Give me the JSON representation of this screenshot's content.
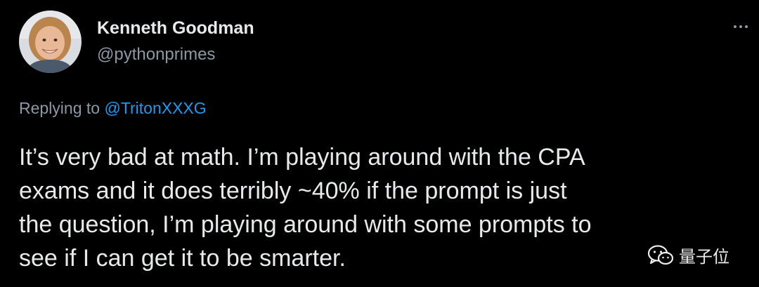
{
  "author": {
    "display_name": "Kenneth Goodman",
    "handle": "@pythonprimes",
    "avatar_icon": "user-avatar-photo"
  },
  "menu": {
    "icon": "more-horizontal-icon"
  },
  "reply": {
    "prefix": "Replying to ",
    "mention": "@TritonXXXG"
  },
  "tweet": {
    "text": "It’s very bad at math. I’m playing around with the CPA\nexams and it does terribly ~40% if the prompt is just\nthe question, I’m playing around with some prompts to\nsee if I can get it to be smarter."
  },
  "watermark": {
    "icon": "wechat-icon",
    "label": "量子位"
  },
  "colors": {
    "background": "#000000",
    "primary_text": "#e7e9ea",
    "secondary_text": "#8b98a5",
    "link": "#1d9bf0"
  }
}
